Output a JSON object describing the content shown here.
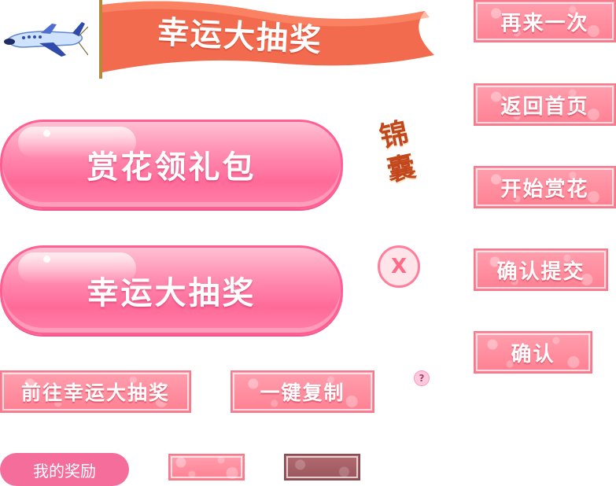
{
  "banner": {
    "title": "幸运大抽奖"
  },
  "pills": {
    "gift_label": "赏花领礼包",
    "lottery_label": "幸运大抽奖"
  },
  "side_title": {
    "line1": "锦",
    "line2": "囊"
  },
  "buttons": {
    "again": "再来一次",
    "home": "返回首页",
    "start": "开始赏花",
    "confirm_submit": "确认提交",
    "confirm": "确认",
    "go_lottery": "前往幸运大抽奖",
    "copy": "一键复制",
    "my_rewards": "我的奖励"
  },
  "icons": {
    "close": "close-icon",
    "help": "help-icon",
    "plane": "plane-icon"
  },
  "close_glyph": "X",
  "help_glyph": "?",
  "colors": {
    "banner_red": "#f26b4e",
    "pill_pink": "#ff6a99",
    "flower_btn": "#ff8fa0",
    "flower_btn_dark": "#a85f66",
    "side_title": "#c2471c",
    "rewards": "#f56d9a"
  }
}
